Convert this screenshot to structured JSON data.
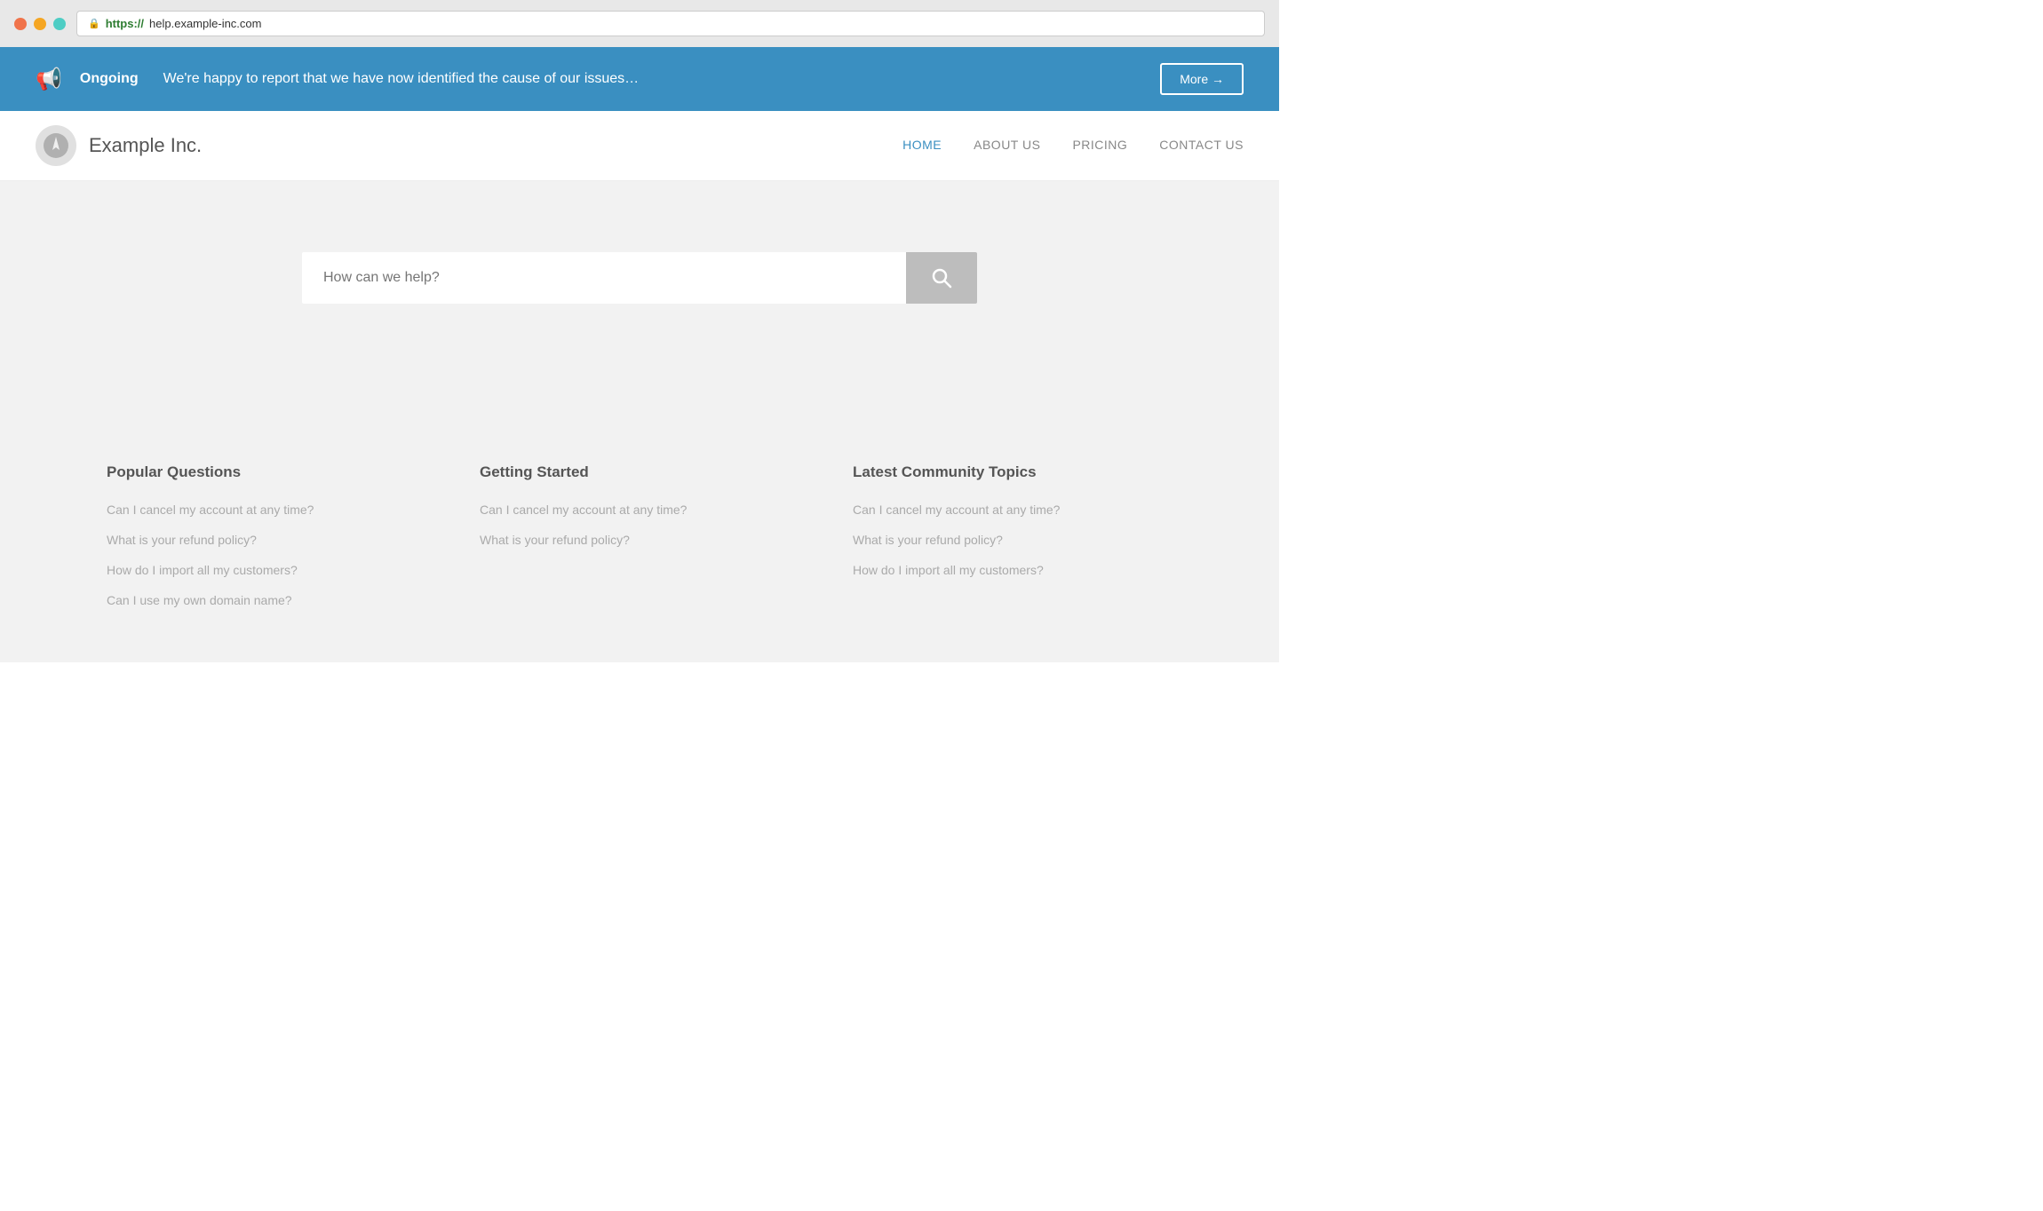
{
  "browser": {
    "url_https": "https://",
    "url_rest": "help.example-inc.com"
  },
  "banner": {
    "ongoing_label": "Ongoing",
    "message": "We're happy to report that we have now identified the cause of our issues…",
    "more_button": "More →"
  },
  "navbar": {
    "brand_name": "Example Inc.",
    "nav_links": [
      {
        "label": "HOME",
        "active": true
      },
      {
        "label": "ABOUT US",
        "active": false
      },
      {
        "label": "PRICING",
        "active": false
      },
      {
        "label": "CONTACT US",
        "active": false
      }
    ]
  },
  "hero": {
    "search_placeholder": "How can we help?"
  },
  "sections": [
    {
      "title": "Popular Questions",
      "links": [
        "Can I cancel my account at any time?",
        "What is your refund policy?",
        "How do I import all my customers?",
        "Can I use my own domain name?"
      ]
    },
    {
      "title": "Getting Started",
      "links": [
        "Can I cancel my account at any time?",
        "What is your refund policy?"
      ]
    },
    {
      "title": "Latest Community Topics",
      "links": [
        "Can I cancel my account at any time?",
        "What is your refund policy?",
        "How do I import all my customers?"
      ]
    }
  ]
}
